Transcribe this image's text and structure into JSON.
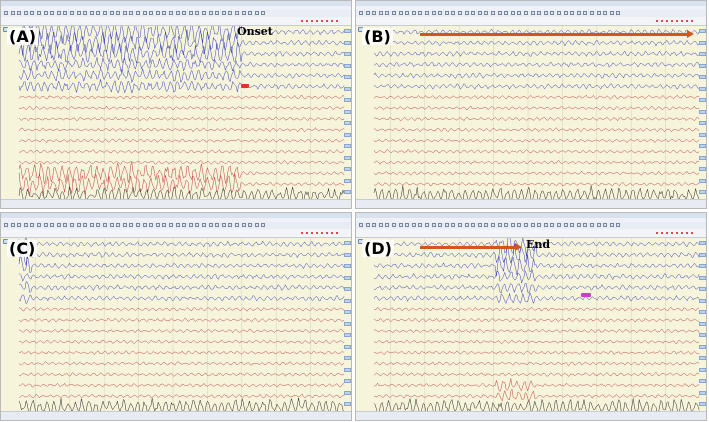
{
  "panels": [
    {
      "id": "A",
      "label": "(A)",
      "event": {
        "text": "Onset",
        "show_arrow": false
      },
      "highlight_red_tag": true,
      "highlight_magenta_tag": false
    },
    {
      "id": "B",
      "label": "(B)",
      "event": {
        "text": "",
        "show_arrow": true
      },
      "highlight_red_tag": false,
      "highlight_magenta_tag": false
    },
    {
      "id": "C",
      "label": "(C)",
      "event": {
        "text": "",
        "show_arrow": false
      },
      "highlight_red_tag": false,
      "highlight_magenta_tag": false
    },
    {
      "id": "D",
      "label": "(D)",
      "event": {
        "text": "End",
        "show_arrow": true
      },
      "highlight_red_tag": false,
      "highlight_magenta_tag": true
    }
  ],
  "colors": {
    "trace_blue": "#1f2fb8",
    "trace_red": "#b52a2a",
    "trace_black": "#111111",
    "grid_line": "#c9c9a8",
    "background": "#f7f4dc",
    "arrow": "#d1571e"
  },
  "icons": {
    "toolbar": "toolbar-button-icon",
    "side": "channel-scale-icon"
  }
}
